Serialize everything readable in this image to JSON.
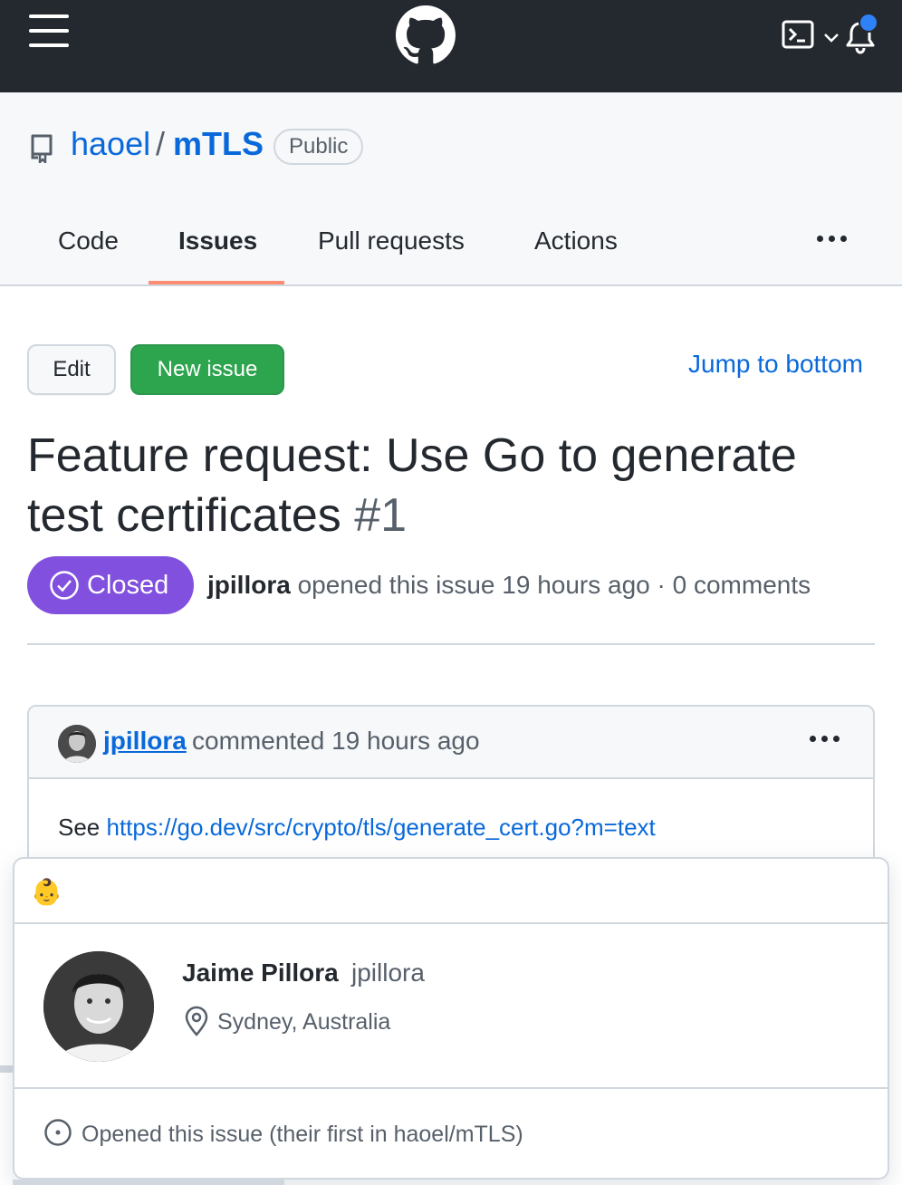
{
  "header": {
    "icons": [
      "hamburger-icon",
      "github-logo",
      "terminal-icon",
      "chevron-down-icon",
      "bell-icon"
    ],
    "notification_color": "#2f81f7"
  },
  "repo": {
    "owner": "haoel",
    "separator": "/",
    "name": "mTLS",
    "visibility": "Public"
  },
  "tabs": [
    {
      "label": "Code"
    },
    {
      "label": "Issues",
      "active": true
    },
    {
      "label": "Pull requests"
    },
    {
      "label": "Actions"
    }
  ],
  "actions": {
    "edit_label": "Edit",
    "new_issue_label": "New issue",
    "jump_label": "Jump to bottom"
  },
  "issue": {
    "title": "Feature request: Use Go to generate test certificates",
    "number": "#1",
    "state": "Closed",
    "state_color": "#8250df",
    "author": "jpillora",
    "opened_text": "opened this issue 19 hours ago · 0 comments"
  },
  "comment": {
    "author": "jpillora",
    "action_text": "commented 19 hours ago",
    "body_prefix": "See",
    "body_link": "https://go.dev/src/crypto/tls/generate_cert.go?m=text"
  },
  "hovercard": {
    "emoji": "👶",
    "name": "Jaime Pillora",
    "login": "jpillora",
    "location": "Sydney, Australia",
    "note": "Opened this issue (their first in haoel/mTLS)"
  }
}
